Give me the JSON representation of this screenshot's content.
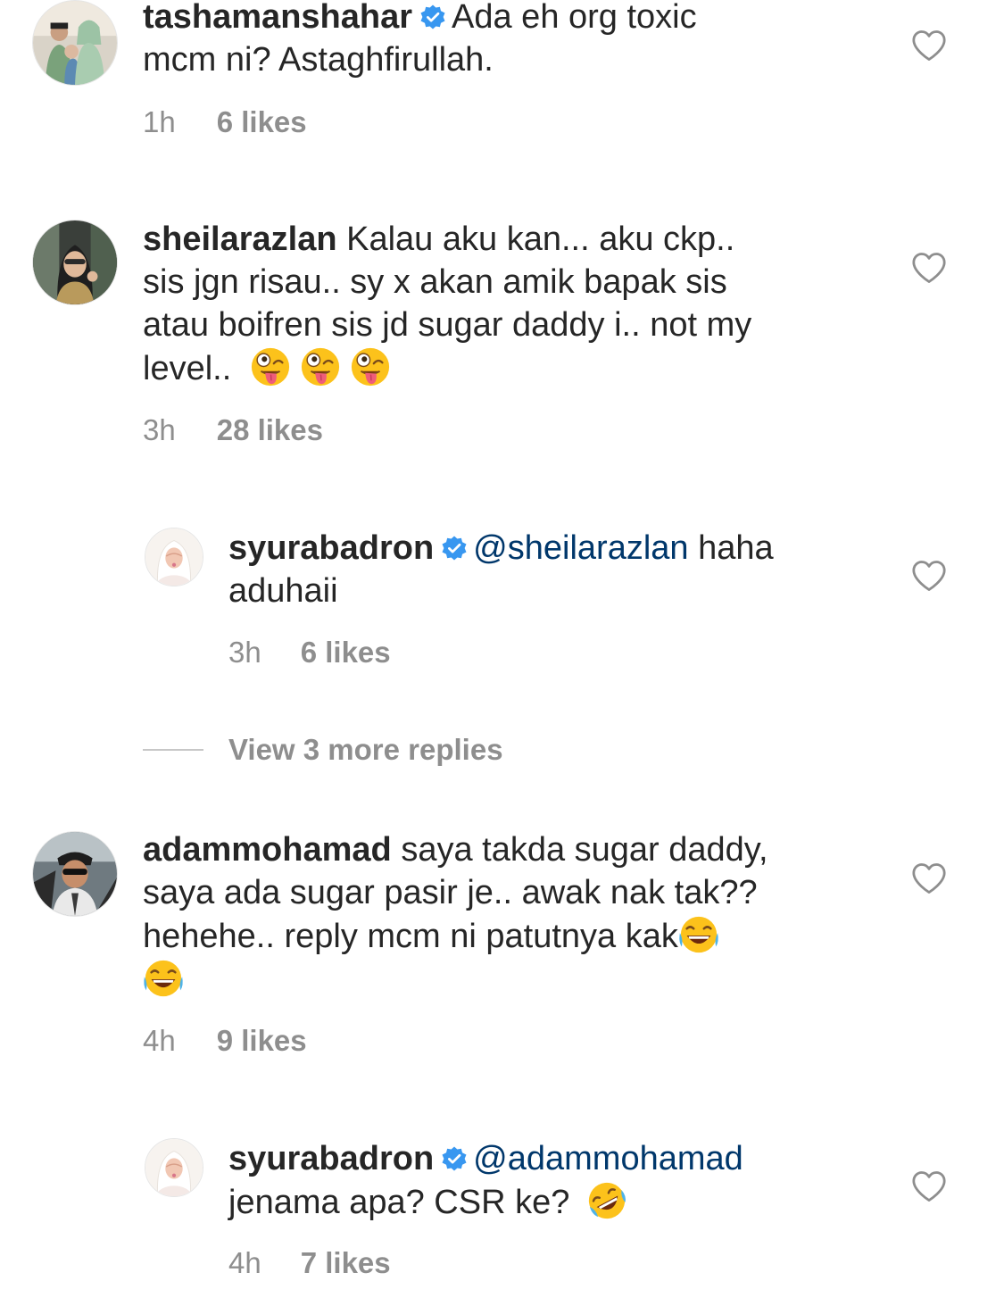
{
  "comments": [
    {
      "username": "tashamanshahar",
      "verified": true,
      "text_line1": "Ada eh org toxic",
      "text_line2": "mcm ni? Astaghfirullah.",
      "time": "1h",
      "likes": "6 likes"
    },
    {
      "username": "sheilarazlan",
      "verified": false,
      "text_line1": "Kalau aku kan... aku ckp..",
      "text_line2": "sis jgn risau.. sy x akan amik bapak sis",
      "text_line3": "atau boifren sis jd sugar daddy i.. not my",
      "text_line4": "level..",
      "emojis": [
        "zany-face",
        "zany-face",
        "zany-face"
      ],
      "time": "3h",
      "likes": "28 likes",
      "replies": [
        {
          "username": "syurabadron",
          "verified": true,
          "mention": "@sheilarazlan",
          "text_line1": " haha",
          "text_line2": "aduhaii",
          "time": "3h",
          "likes": "6 likes"
        }
      ],
      "view_more_replies": "View 3 more replies"
    },
    {
      "username": "adammohamad",
      "verified": false,
      "text_line1": "saya takda sugar daddy,",
      "text_line2": "saya ada sugar pasir je.. awak nak tak??",
      "text_line3": "hehehe.. reply mcm ni patutnya kak",
      "emojis": [
        "tears-of-joy-face",
        "tears-of-joy-face"
      ],
      "time": "4h",
      "likes": "9 likes",
      "replies": [
        {
          "username": "syurabadron",
          "verified": true,
          "mention": "@adammohamad",
          "text_line2": "jenama apa? CSR ke?",
          "emoji": "rolling-on-floor-laughing-face",
          "time": "4h",
          "likes": "7 likes"
        }
      ]
    }
  ],
  "colors": {
    "text": "#262626",
    "secondary": "#8e8e8e",
    "mention": "#00376b",
    "verified_badge": "#3897f0",
    "heart_outline": "#8e8e8e"
  }
}
